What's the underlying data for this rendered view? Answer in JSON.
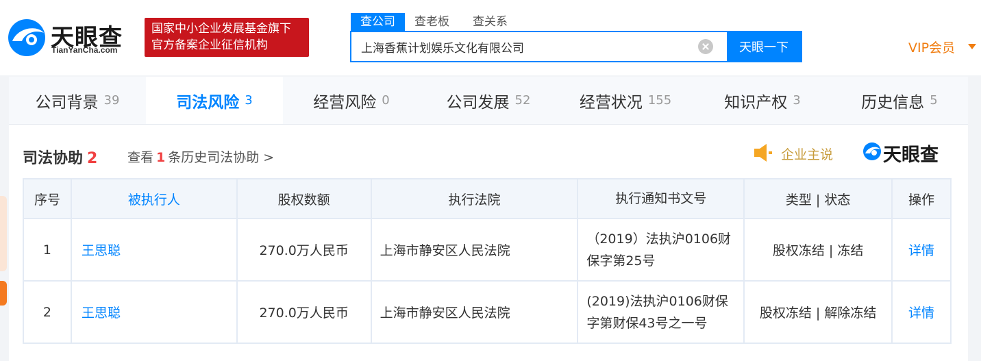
{
  "header": {
    "logo_text": "天眼查",
    "logo_sub": "TianYanCha.com",
    "badge_line1": "国家中小企业发展基金旗下",
    "badge_line2": "官方备案企业征信机构",
    "search_tabs": [
      "查公司",
      "查老板",
      "查关系"
    ],
    "search_value": "上海香蕉计划娱乐文化有限公司",
    "search_button": "天眼一下",
    "vip_label": "VIP会员"
  },
  "nav": {
    "tabs": [
      {
        "label": "公司背景",
        "count": "39"
      },
      {
        "label": "司法风险",
        "count": "3"
      },
      {
        "label": "经营风险",
        "count": "0"
      },
      {
        "label": "公司发展",
        "count": "52"
      },
      {
        "label": "经营状况",
        "count": "155"
      },
      {
        "label": "知识产权",
        "count": "3"
      },
      {
        "label": "历史信息",
        "count": "5"
      }
    ]
  },
  "section": {
    "title": "司法协助",
    "count": "2",
    "history_prefix": "查看",
    "history_count": "1",
    "history_suffix": "条历史司法协助 >",
    "owner_say": "企业主说",
    "mini_logo": "天眼查"
  },
  "table": {
    "headers": [
      "序号",
      "被执行人",
      "股权数额",
      "执行法院",
      "执行通知书文号",
      "类型 | 状态",
      "操作"
    ],
    "rows": [
      {
        "no": "1",
        "person": "王思聪",
        "amount": "270.0万人民币",
        "court": "上海市静安区人民法院",
        "doc": "（2019）法执沪0106财保字第25号",
        "type_status": "股权冻结 | 冻结",
        "op": "详情"
      },
      {
        "no": "2",
        "person": "王思聪",
        "amount": "270.0万人民币",
        "court": "上海市静安区人民法院",
        "doc": "(2019)法执沪0106财保字第财保43号之一号",
        "type_status": "股权冻结 | 解除冻结",
        "op": "详情"
      }
    ]
  },
  "colors": {
    "brand_blue": "#0084ff",
    "badge_red": "#c8161d",
    "vip_orange": "#f07d11",
    "count_red": "#f04142"
  }
}
